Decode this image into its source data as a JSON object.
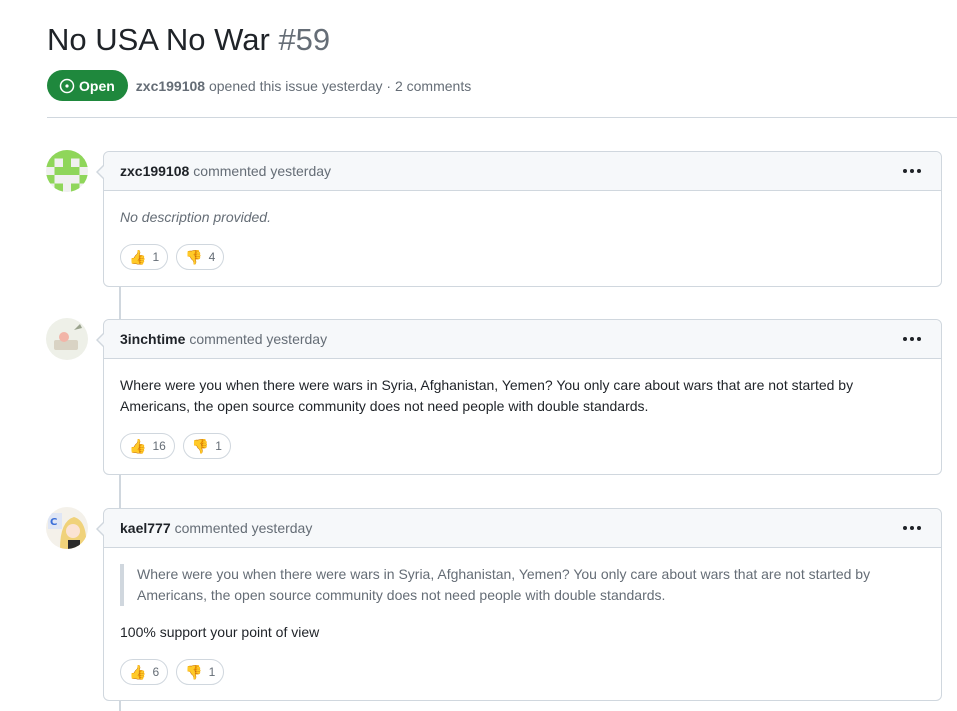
{
  "issue": {
    "title": "No USA No War",
    "number": "#59",
    "state": "Open",
    "author": "zxc199108",
    "meta_text": "opened this issue yesterday · 2 comments"
  },
  "comments": [
    {
      "author": "zxc199108",
      "action": "commented yesterday",
      "body": "No description provided.",
      "reactions": [
        {
          "emoji": "👍",
          "count": "1"
        },
        {
          "emoji": "👎",
          "count": "4"
        }
      ]
    },
    {
      "author": "3inchtime",
      "action": "commented yesterday",
      "body": "Where were you when there were wars in Syria, Afghanistan, Yemen? You only care about wars that are not started by Americans, the open source community does not need people with double standards.",
      "reactions": [
        {
          "emoji": "👍",
          "count": "16"
        },
        {
          "emoji": "👎",
          "count": "1"
        }
      ]
    },
    {
      "author": "kael777",
      "action": "commented yesterday",
      "quote": "Where were you when there were wars in Syria, Afghanistan, Yemen? You only care about wars that are not started by Americans, the open source community does not need people with double standards.",
      "body": "100% support your point of view",
      "reactions": [
        {
          "emoji": "👍",
          "count": "6"
        },
        {
          "emoji": "👎",
          "count": "1"
        }
      ]
    }
  ],
  "colors": {
    "open_badge": "#1f883d",
    "border": "#d0d7de",
    "header_bg": "#f6f8fa",
    "muted_text": "#656d76"
  },
  "icons": {
    "open_state": "issue-opened-icon",
    "more": "kebab-horizontal-icon"
  }
}
